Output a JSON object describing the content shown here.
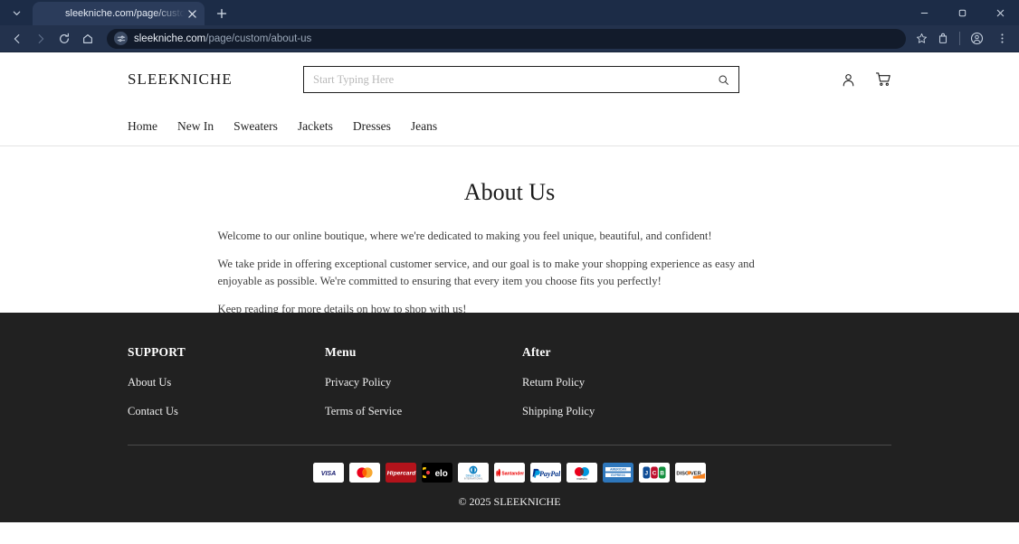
{
  "browser": {
    "tab": {
      "title": "sleekniche.com/page/custom/a"
    },
    "new_tab_label": "+",
    "url_domain": "sleekniche.com",
    "url_path": "/page/custom/about-us",
    "window": {
      "minimize": "—",
      "maximize": "▢",
      "close": "✕"
    }
  },
  "site": {
    "logo": "SLEEKNICHE",
    "search": {
      "placeholder": "Start Typing Here",
      "value": ""
    },
    "nav": [
      {
        "label": "Home"
      },
      {
        "label": "New In"
      },
      {
        "label": "Sweaters"
      },
      {
        "label": "Jackets"
      },
      {
        "label": "Dresses"
      },
      {
        "label": "Jeans"
      }
    ]
  },
  "main": {
    "title": "About Us",
    "paragraphs": [
      "Welcome to our online boutique, where we're dedicated to making you feel unique, beautiful, and confident!",
      "We take pride in offering exceptional customer service, and our goal is to make your shopping experience as easy and enjoyable as possible. We're committed to ensuring that every item you choose fits you perfectly!",
      "Keep reading for more details on how to shop with us!"
    ]
  },
  "footer": {
    "columns": [
      {
        "heading": "SUPPORT",
        "links": [
          {
            "label": "About Us"
          },
          {
            "label": "Contact Us"
          }
        ]
      },
      {
        "heading": "Menu",
        "links": [
          {
            "label": "Privacy Policy"
          },
          {
            "label": "Terms of Service"
          }
        ]
      },
      {
        "heading": "After",
        "links": [
          {
            "label": "Return Policy"
          },
          {
            "label": "Shipping Policy"
          }
        ]
      }
    ],
    "payment_methods": [
      {
        "name": "visa"
      },
      {
        "name": "mastercard"
      },
      {
        "name": "hipercard"
      },
      {
        "name": "elo"
      },
      {
        "name": "diners-club"
      },
      {
        "name": "santander"
      },
      {
        "name": "paypal"
      },
      {
        "name": "maestro"
      },
      {
        "name": "american-express"
      },
      {
        "name": "jcb"
      },
      {
        "name": "discover"
      }
    ],
    "copyright": "© 2025 SLEEKNICHE"
  },
  "colors": {
    "chrome": "#1c2c47",
    "toolbar": "#23324d",
    "omnibox": "#121b2b",
    "footer_bg": "#212121",
    "page_bg": "#ffffff",
    "text": "#1f1f1f"
  }
}
